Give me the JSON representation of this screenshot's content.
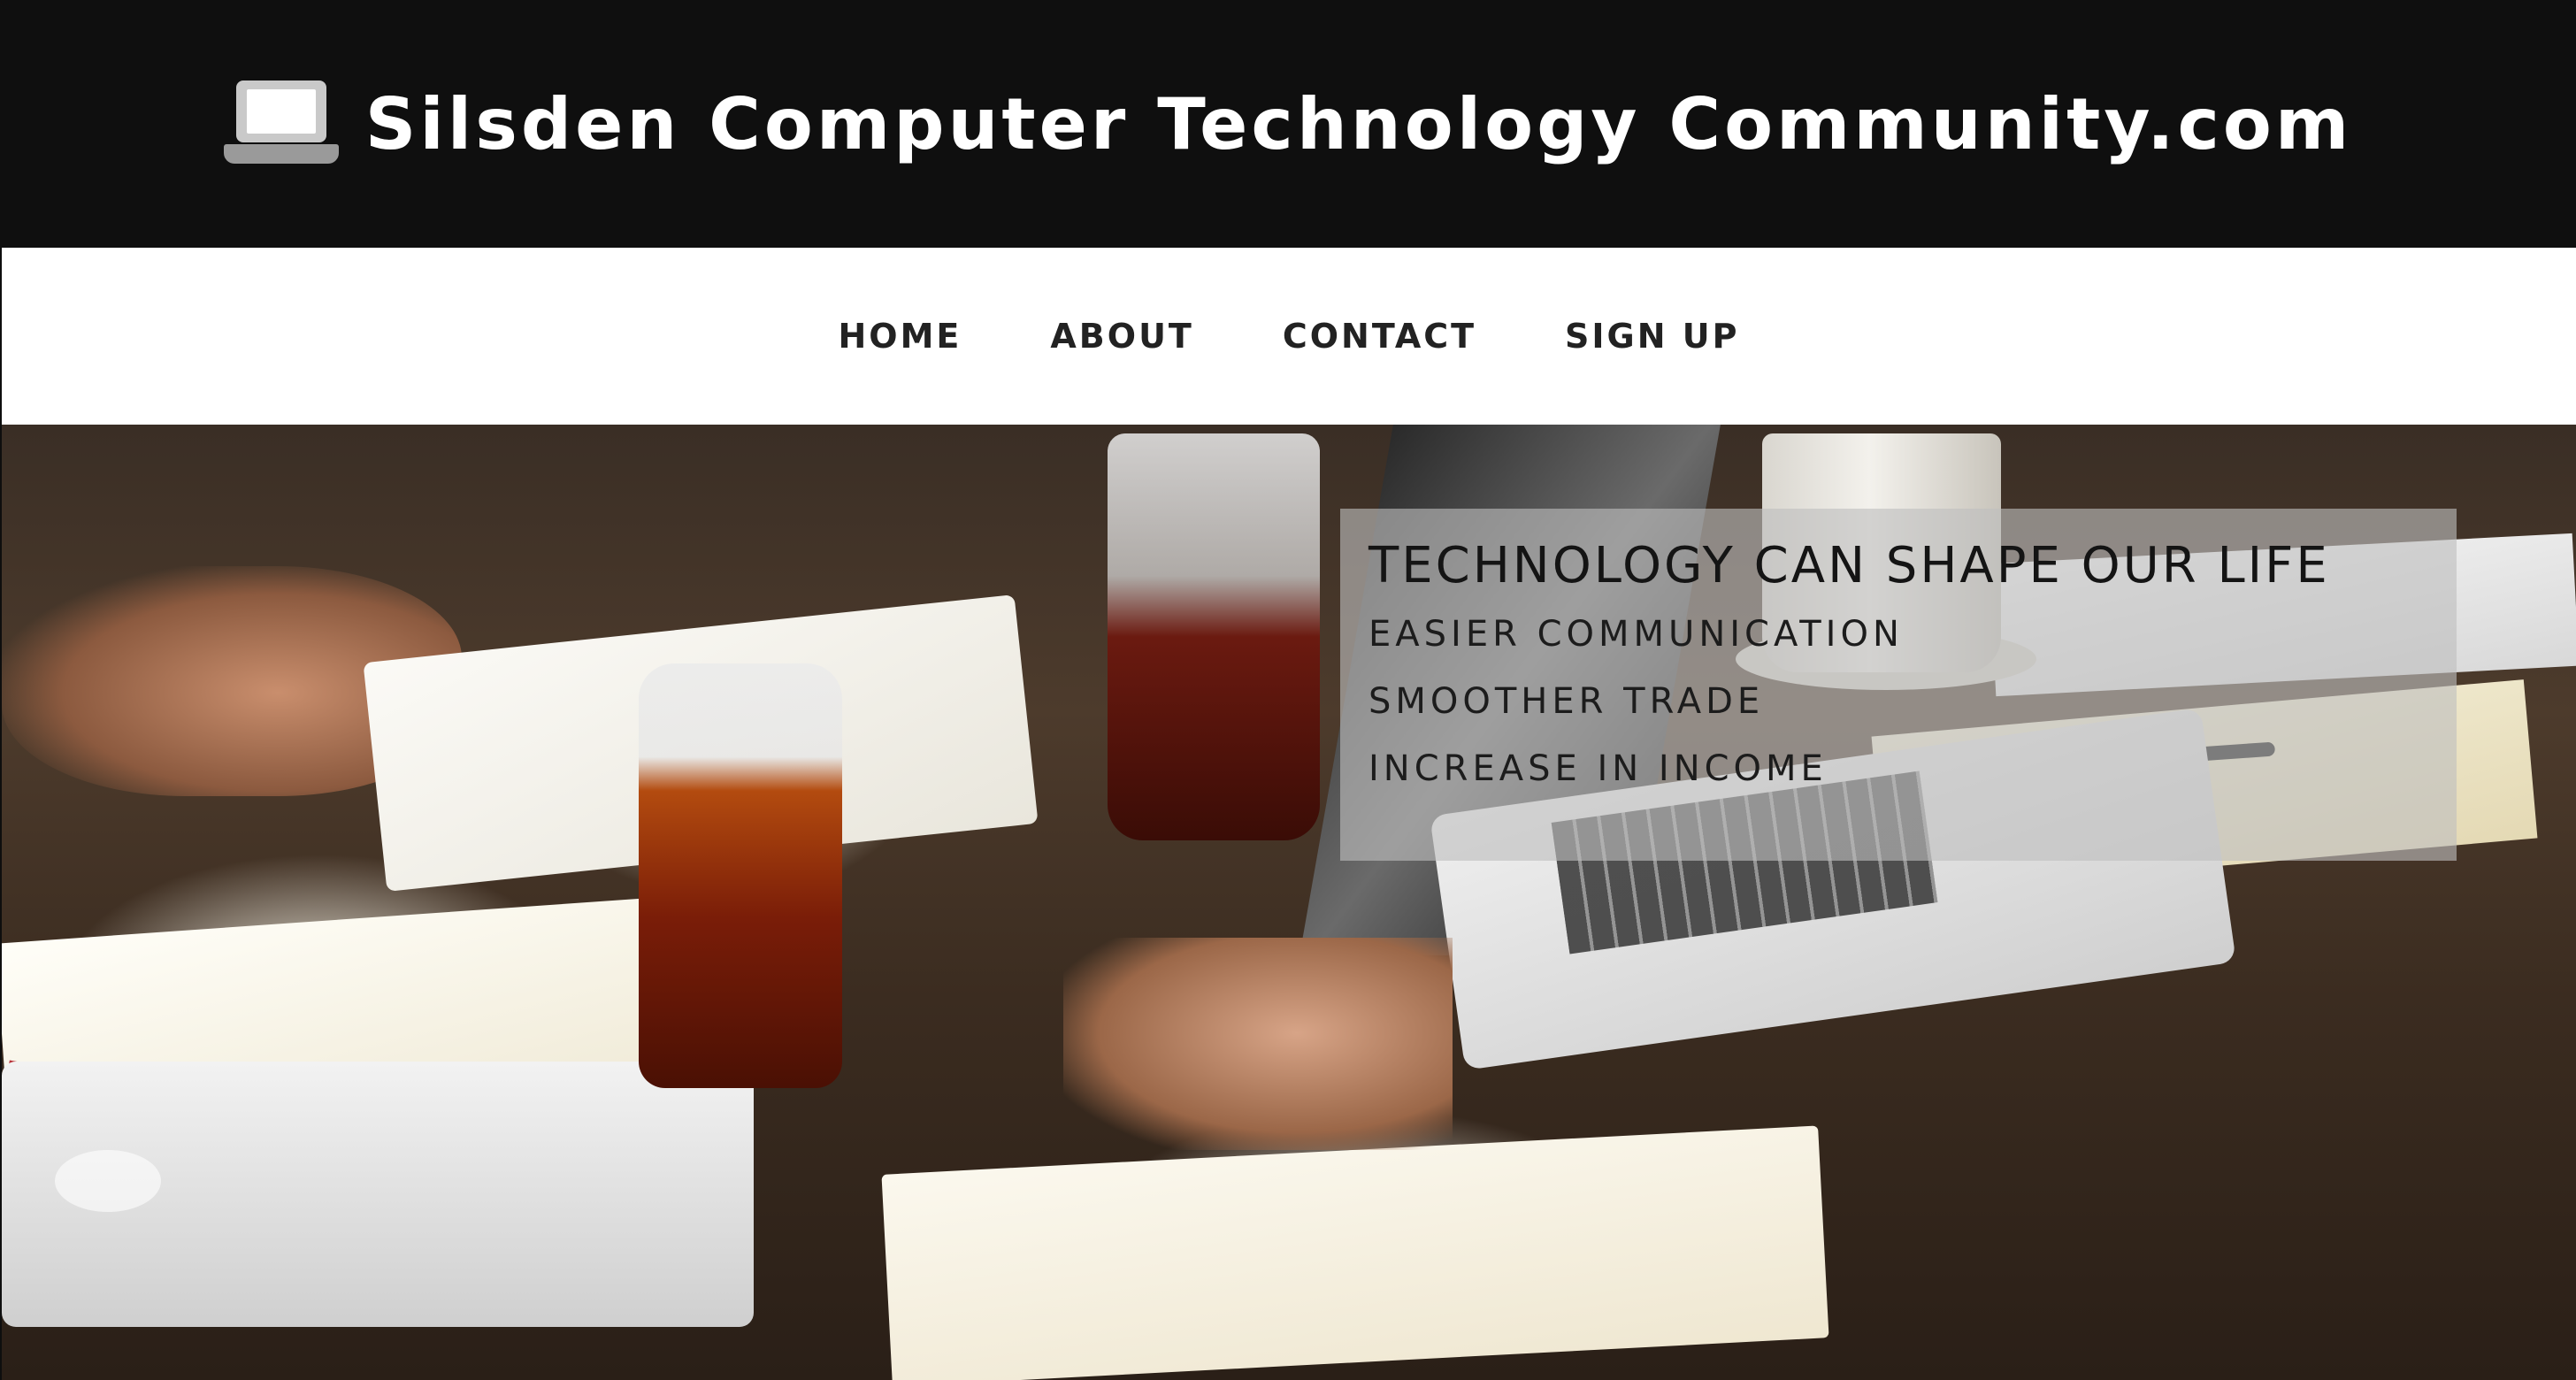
{
  "header": {
    "icon": "laptop-icon",
    "title": "Silsden Computer Technology Community.com",
    "background": "#0f0f0f",
    "text_color": "#ffffff"
  },
  "nav": {
    "items": [
      {
        "label": "HOME"
      },
      {
        "label": "ABOUT"
      },
      {
        "label": "CONTACT"
      },
      {
        "label": "SIGN UP"
      }
    ],
    "background": "#ffffff",
    "text_color": "#222222"
  },
  "hero": {
    "caption": {
      "title": "TECHNOLOGY CAN SHAPE OUR LIFE",
      "lines": [
        "EASIER COMMUNICATION",
        "SMOOTHER TRADE",
        "INCREASE IN INCOME"
      ]
    }
  }
}
